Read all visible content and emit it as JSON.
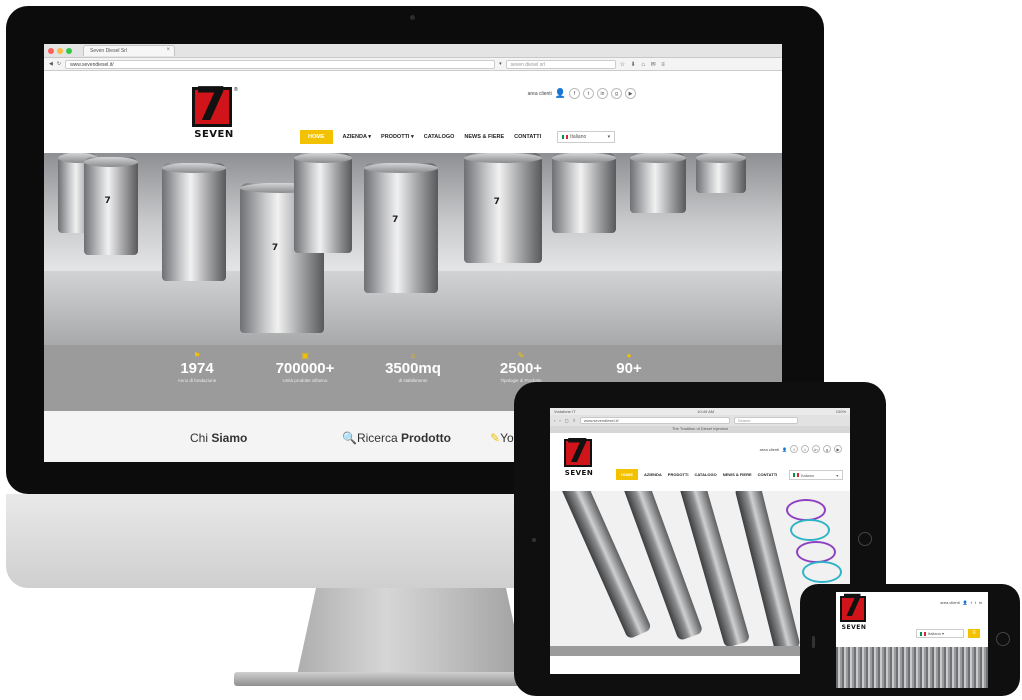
{
  "imac": {
    "tab_title": "Seven Diesel Srl",
    "url": "www.sevendiesel.it/",
    "search": "seven diesel srl",
    "area_clienti": "area clienti",
    "nav": [
      "HOME",
      "AZIENDA",
      "PRODOTTI",
      "CATALOGO",
      "NEWS & FIERE",
      "CONTATTI"
    ],
    "lang": "Italiano",
    "stats": [
      {
        "num": "1974",
        "label": "Anno di fondazione"
      },
      {
        "num": "700000+",
        "label": "Unità prodotte all'anno"
      },
      {
        "num": "3500mq",
        "label": "di stabilimento"
      },
      {
        "num": "2500+",
        "label": "Tipologie di Prodotto"
      },
      {
        "num": "90+",
        "label": ""
      }
    ],
    "links": [
      {
        "pre": "Chi ",
        "bold": "Siamo"
      },
      {
        "pre": "Ricerca ",
        "bold": "Prodotto"
      },
      {
        "pre": "Yo",
        "bold": ""
      }
    ]
  },
  "logo": {
    "word": "SEVEN",
    "digit": "7",
    "reg": "®"
  },
  "ipad": {
    "status_left": "Vodafone IT",
    "status_time": "10:49 AM",
    "status_right": "100%",
    "url": "www.sevendiesel.it/",
    "search": "Search",
    "tabline": "The Tradition of Diesel Injection",
    "area_clienti": "area clienti",
    "nav": [
      "HOME",
      "AZIENDA",
      "PRODOTTI",
      "CATALOGO",
      "NEWS & FIERE",
      "CONTATTI"
    ],
    "lang": "Italiano"
  },
  "iphone": {
    "area_clienti": "area clienti",
    "lang": "Italiano",
    "menu": "≡"
  },
  "colors": {
    "accent": "#f2c100",
    "brand_red": "#d0141a",
    "band": "#9b9b9b"
  }
}
